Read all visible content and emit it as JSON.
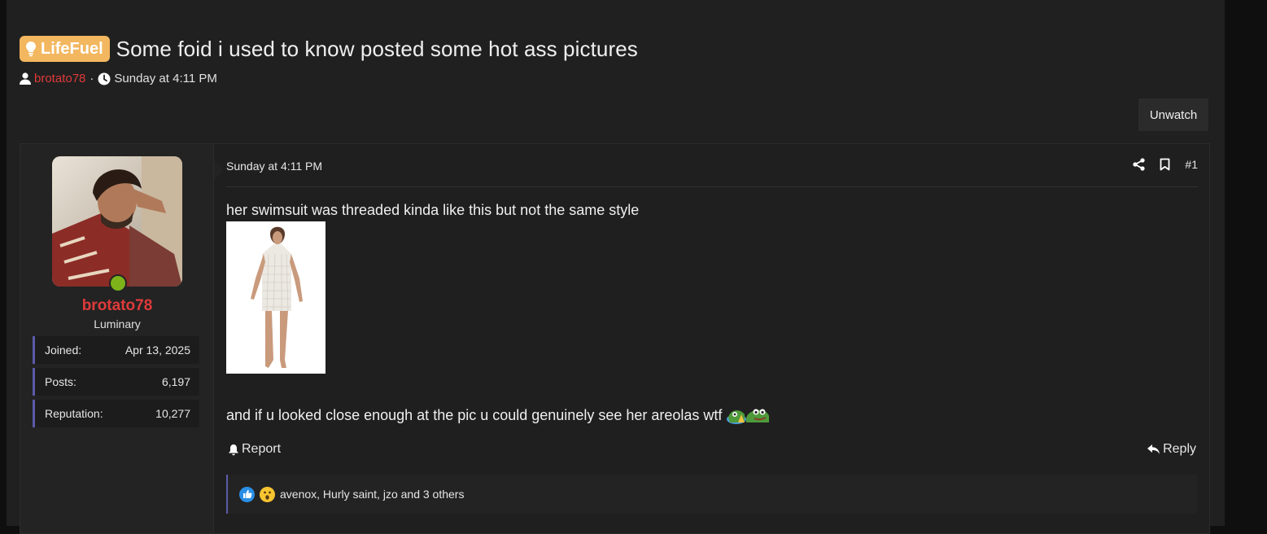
{
  "thread": {
    "prefix": "LifeFuel",
    "title": "Some foid i used to know posted some hot ass pictures",
    "author": "brotato78",
    "separator": "·",
    "date": "Sunday at 4:11 PM"
  },
  "toolbar": {
    "unwatch_label": "Unwatch"
  },
  "post": {
    "user": {
      "name": "brotato78",
      "title": "Luminary",
      "stats": [
        {
          "label": "Joined:",
          "value": "Apr 13, 2025"
        },
        {
          "label": "Posts:",
          "value": "6,197"
        },
        {
          "label": "Reputation:",
          "value": "10,277"
        }
      ]
    },
    "date": "Sunday at 4:11 PM",
    "number": "#1",
    "text1": "her swimsuit was threaded kinda like this but not the same style",
    "text2": "and if u looked close enough at the pic u could genuinely see her areolas wtf",
    "report_label": "Report",
    "reply_label": "Reply",
    "reactions_text": "avenox, Hurly saint, jzo and 3 others"
  },
  "colors": {
    "background": "#202020",
    "username": "#e03a3a",
    "prefix": "#f3b760",
    "online": "#7db21b",
    "stat_accent": "#5b5ba8"
  },
  "icons": [
    "lightbulb-icon",
    "user-icon",
    "clock-icon",
    "share-icon",
    "bookmark-icon",
    "bell-icon",
    "reply-icon",
    "like-icon",
    "wow-icon",
    "pepe-emoji-icon"
  ]
}
